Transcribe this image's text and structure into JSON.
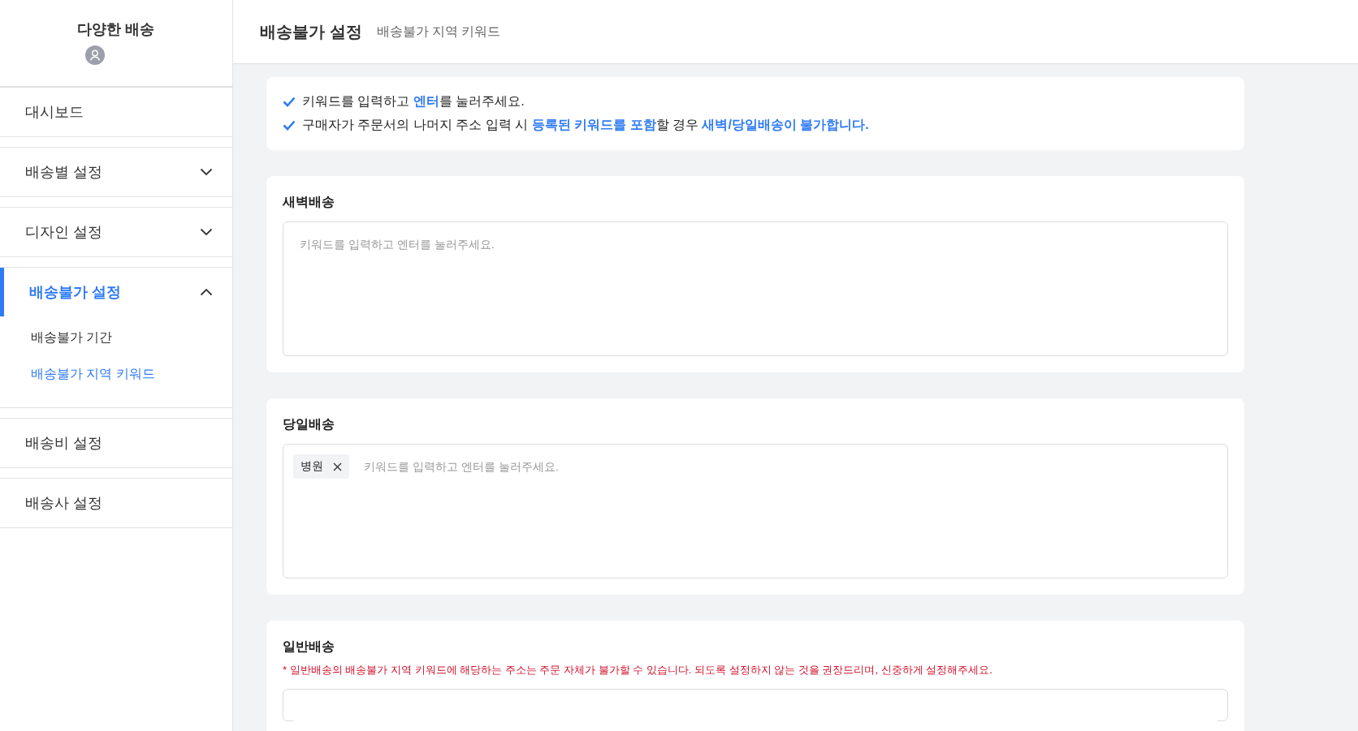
{
  "sidebar": {
    "title": "다양한 배송",
    "items": [
      {
        "kind": "link",
        "label": "대시보드",
        "selected": false
      },
      {
        "kind": "group",
        "label": "배송별 설정",
        "selected": false,
        "expanded": false
      },
      {
        "kind": "group",
        "label": "디자인 설정",
        "selected": false,
        "expanded": false
      },
      {
        "kind": "group",
        "label": "배송불가 설정",
        "selected": true,
        "expanded": true,
        "children": [
          {
            "label": "배송불가 기간",
            "selected": false
          },
          {
            "label": "배송불가 지역 키워드",
            "selected": true
          }
        ]
      },
      {
        "kind": "link",
        "label": "배송비 설정",
        "selected": false
      },
      {
        "kind": "link",
        "label": "배송사 설정",
        "selected": false
      }
    ]
  },
  "header": {
    "title": "배송불가 설정",
    "subtitle": "배송불가 지역 키워드"
  },
  "info": [
    "키워드를 입력하고 **엔터**를 눌러주세요.",
    "구매자가 주문서의 나머지 주소 입력 시 **등록된 키워드를 포함**할 경우 **새벽/당일배송이 불가합니다.**"
  ],
  "sections": [
    {
      "title": "새벽배송",
      "placeholder": "키워드를 입력하고 엔터를 눌러주세요."
    },
    {
      "title": "당일배송",
      "placeholder": "키워드를 입력하고 엔터를 눌러주세요.",
      "tags": [
        {
          "label": "병원"
        }
      ]
    },
    {
      "title": "일반배송",
      "note": "* 일반배송의 배송불가 지역 키워드에 해당하는 주소는 주문 자체가 불가할 수 있습니다. 되도록 설정하지 않는 것을 권장드리며, 신중하게 설정해주세요."
    }
  ]
}
